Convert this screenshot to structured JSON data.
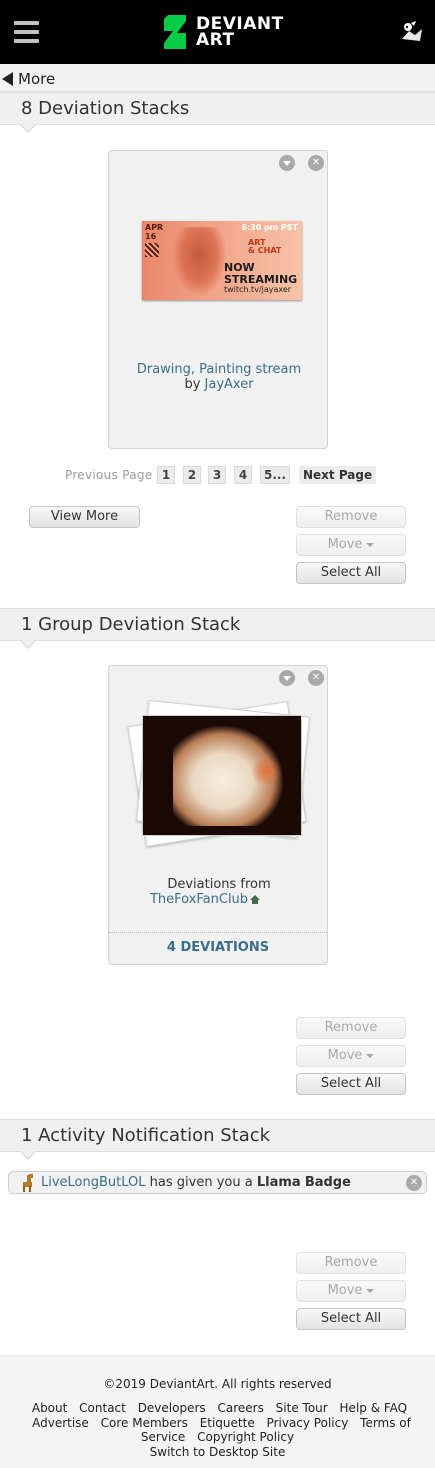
{
  "header": {
    "logo_line1": "DEVIANT",
    "logo_line2": "ART",
    "brand_green": "#05cc47"
  },
  "nav": {
    "back_label": "More"
  },
  "deviation_stacks": {
    "title": "8 Deviation Stacks",
    "card": {
      "thumb": {
        "date_month": "APR",
        "date_day": "16",
        "time": "6:30 pm PST",
        "art_line1": "ART",
        "art_line2": "& CHAT",
        "now_line1": "NOW",
        "now_line2": "STREAMING",
        "url": "twitch.tv/jayaxer"
      },
      "title": "Drawing, Painting stream",
      "by_label": "by",
      "author": "JayAxer"
    },
    "pager": {
      "prev": "Previous Page",
      "pages": [
        "1",
        "2",
        "3",
        "4",
        "5..."
      ],
      "next": "Next Page"
    },
    "view_more": "View More",
    "remove": "Remove",
    "move": "Move",
    "select_all": "Select All"
  },
  "group_stacks": {
    "title": "1 Group Deviation Stack",
    "card": {
      "caption": "Deviations from",
      "group": "TheFoxFanClub",
      "footer": "4 DEVIATIONS"
    },
    "remove": "Remove",
    "move": "Move",
    "select_all": "Select All"
  },
  "activity_stacks": {
    "title": "1 Activity Notification Stack",
    "notification": {
      "user": "LiveLongButLOL",
      "text": "has given you a",
      "badge_name": "Llama",
      "badge_word": "Badge"
    },
    "remove": "Remove",
    "move": "Move",
    "select_all": "Select All"
  },
  "footer": {
    "copyright": "©2019 DeviantArt. All rights reserved",
    "links": [
      "About",
      "Contact",
      "Developers",
      "Careers",
      "Site Tour",
      "Help & FAQ",
      "Advertise",
      "Core Members",
      "Etiquette",
      "Privacy Policy",
      "Terms of Service",
      "Copyright Policy"
    ],
    "desktop": "Switch to Desktop Site"
  }
}
